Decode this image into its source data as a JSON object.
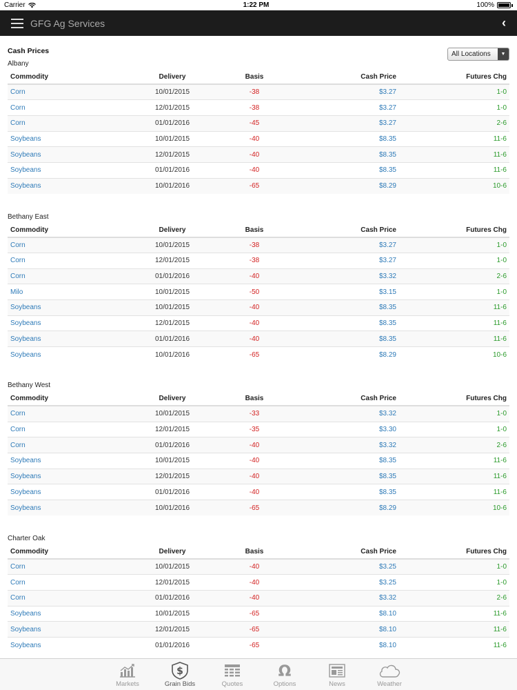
{
  "status_bar": {
    "carrier": "Carrier",
    "time": "1:22 PM",
    "battery": "100%"
  },
  "navbar": {
    "title": "GFG Ag Services"
  },
  "page": {
    "title": "Cash Prices",
    "location_filter": "All Locations"
  },
  "columns": {
    "commodity": "Commodity",
    "delivery": "Delivery",
    "basis": "Basis",
    "cash_price": "Cash Price",
    "futures_chg": "Futures Chg"
  },
  "locations": [
    {
      "name": "Albany",
      "rows": [
        {
          "commodity": "Corn",
          "delivery": "10/01/2015",
          "basis": "-38",
          "cash_price": "$3.27",
          "futures_chg": "1-0"
        },
        {
          "commodity": "Corn",
          "delivery": "12/01/2015",
          "basis": "-38",
          "cash_price": "$3.27",
          "futures_chg": "1-0"
        },
        {
          "commodity": "Corn",
          "delivery": "01/01/2016",
          "basis": "-45",
          "cash_price": "$3.27",
          "futures_chg": "2-6"
        },
        {
          "commodity": "Soybeans",
          "delivery": "10/01/2015",
          "basis": "-40",
          "cash_price": "$8.35",
          "futures_chg": "11-6"
        },
        {
          "commodity": "Soybeans",
          "delivery": "12/01/2015",
          "basis": "-40",
          "cash_price": "$8.35",
          "futures_chg": "11-6"
        },
        {
          "commodity": "Soybeans",
          "delivery": "01/01/2016",
          "basis": "-40",
          "cash_price": "$8.35",
          "futures_chg": "11-6"
        },
        {
          "commodity": "Soybeans",
          "delivery": "10/01/2016",
          "basis": "-65",
          "cash_price": "$8.29",
          "futures_chg": "10-6"
        }
      ]
    },
    {
      "name": "Bethany East",
      "rows": [
        {
          "commodity": "Corn",
          "delivery": "10/01/2015",
          "basis": "-38",
          "cash_price": "$3.27",
          "futures_chg": "1-0"
        },
        {
          "commodity": "Corn",
          "delivery": "12/01/2015",
          "basis": "-38",
          "cash_price": "$3.27",
          "futures_chg": "1-0"
        },
        {
          "commodity": "Corn",
          "delivery": "01/01/2016",
          "basis": "-40",
          "cash_price": "$3.32",
          "futures_chg": "2-6"
        },
        {
          "commodity": "Milo",
          "delivery": "10/01/2015",
          "basis": "-50",
          "cash_price": "$3.15",
          "futures_chg": "1-0"
        },
        {
          "commodity": "Soybeans",
          "delivery": "10/01/2015",
          "basis": "-40",
          "cash_price": "$8.35",
          "futures_chg": "11-6"
        },
        {
          "commodity": "Soybeans",
          "delivery": "12/01/2015",
          "basis": "-40",
          "cash_price": "$8.35",
          "futures_chg": "11-6"
        },
        {
          "commodity": "Soybeans",
          "delivery": "01/01/2016",
          "basis": "-40",
          "cash_price": "$8.35",
          "futures_chg": "11-6"
        },
        {
          "commodity": "Soybeans",
          "delivery": "10/01/2016",
          "basis": "-65",
          "cash_price": "$8.29",
          "futures_chg": "10-6"
        }
      ]
    },
    {
      "name": "Bethany West",
      "rows": [
        {
          "commodity": "Corn",
          "delivery": "10/01/2015",
          "basis": "-33",
          "cash_price": "$3.32",
          "futures_chg": "1-0"
        },
        {
          "commodity": "Corn",
          "delivery": "12/01/2015",
          "basis": "-35",
          "cash_price": "$3.30",
          "futures_chg": "1-0"
        },
        {
          "commodity": "Corn",
          "delivery": "01/01/2016",
          "basis": "-40",
          "cash_price": "$3.32",
          "futures_chg": "2-6"
        },
        {
          "commodity": "Soybeans",
          "delivery": "10/01/2015",
          "basis": "-40",
          "cash_price": "$8.35",
          "futures_chg": "11-6"
        },
        {
          "commodity": "Soybeans",
          "delivery": "12/01/2015",
          "basis": "-40",
          "cash_price": "$8.35",
          "futures_chg": "11-6"
        },
        {
          "commodity": "Soybeans",
          "delivery": "01/01/2016",
          "basis": "-40",
          "cash_price": "$8.35",
          "futures_chg": "11-6"
        },
        {
          "commodity": "Soybeans",
          "delivery": "10/01/2016",
          "basis": "-65",
          "cash_price": "$8.29",
          "futures_chg": "10-6"
        }
      ]
    },
    {
      "name": "Charter Oak",
      "rows": [
        {
          "commodity": "Corn",
          "delivery": "10/01/2015",
          "basis": "-40",
          "cash_price": "$3.25",
          "futures_chg": "1-0"
        },
        {
          "commodity": "Corn",
          "delivery": "12/01/2015",
          "basis": "-40",
          "cash_price": "$3.25",
          "futures_chg": "1-0"
        },
        {
          "commodity": "Corn",
          "delivery": "01/01/2016",
          "basis": "-40",
          "cash_price": "$3.32",
          "futures_chg": "2-6"
        },
        {
          "commodity": "Soybeans",
          "delivery": "10/01/2015",
          "basis": "-65",
          "cash_price": "$8.10",
          "futures_chg": "11-6"
        },
        {
          "commodity": "Soybeans",
          "delivery": "12/01/2015",
          "basis": "-65",
          "cash_price": "$8.10",
          "futures_chg": "11-6"
        },
        {
          "commodity": "Soybeans",
          "delivery": "01/01/2016",
          "basis": "-65",
          "cash_price": "$8.10",
          "futures_chg": "11-6"
        }
      ]
    }
  ],
  "tabs": [
    {
      "label": "Markets",
      "icon": "chart-icon"
    },
    {
      "label": "Grain Bids",
      "icon": "dollar-shield-icon",
      "active": true
    },
    {
      "label": "Quotes",
      "icon": "quotes-table-icon"
    },
    {
      "label": "Options",
      "icon": "omega-icon"
    },
    {
      "label": "News",
      "icon": "newspaper-icon"
    },
    {
      "label": "Weather",
      "icon": "cloud-icon"
    }
  ],
  "colors": {
    "link": "#2f7bb8",
    "negative": "#d32222",
    "positive": "#2a9a2a",
    "navbar": "#1c1c1c"
  }
}
